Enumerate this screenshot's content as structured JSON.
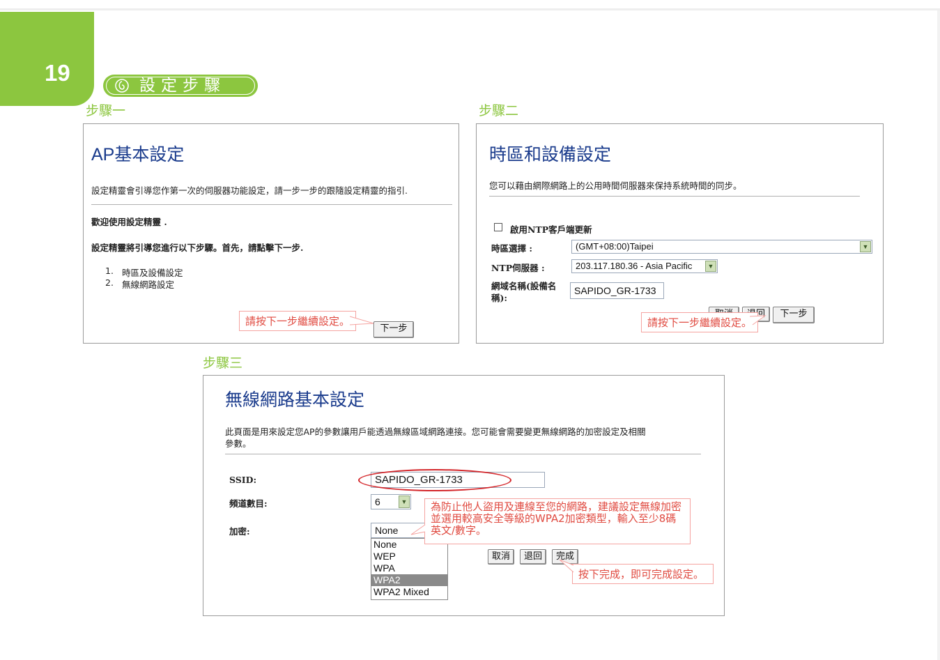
{
  "page": {
    "number": "19",
    "section_title": "設定步驟",
    "accent_color": "#8cc63f",
    "callout_color": "#e04a40"
  },
  "step1": {
    "label": "步驟一",
    "title": "AP基本設定",
    "intro": "設定精靈會引導您作第一次的伺服器功能設定，請一步一步的跟隨設定精靈的指引.",
    "welcome": "歡迎使用設定精靈 .",
    "instruction": "設定精靈將引導您進行以下步驟。首先，請點擊下一步.",
    "list": [
      {
        "num": "1.",
        "text": "時區及設備設定"
      },
      {
        "num": "2.",
        "text": "無線網路設定"
      }
    ],
    "callout": "請按下一步繼續設定。",
    "next_button": "下一步"
  },
  "step2": {
    "label": "步驟二",
    "title": "時區和設備設定",
    "intro": "您可以藉由網際網路上的公用時間伺服器來保持系統時間的同步。",
    "ntp_checkbox_label": "啟用NTP客戶端更新",
    "ntp_checked": false,
    "timezone_label": "時區選擇 :",
    "timezone_value": "(GMT+08:00)Taipei",
    "ntp_server_label": "NTP伺服器 :",
    "ntp_server_value": "203.117.180.36 - Asia Pacific",
    "domain_label_line1": "網域名稱(設備名",
    "domain_label_line2": "稱):",
    "domain_value": "SAPIDO_GR-1733",
    "cancel_button": "取消",
    "back_button": "退回",
    "next_button": "下一步",
    "callout": "請按下一步繼續設定。"
  },
  "step3": {
    "label": "步驟三",
    "title": "無線網路基本設定",
    "intro_line1": "此頁面是用來設定您AP的參數讓用戶能透過無線區域網路連接。您可能會需要變更無線網路的加密設定及相關",
    "intro_line2": "參數。",
    "ssid_label": "SSID:",
    "ssid_value": "SAPIDO_GR-1733",
    "channel_label": "頻道數目:",
    "channel_value": "6",
    "encryption_label": "加密:",
    "encryption_value": "None",
    "encryption_options": [
      "None",
      "WEP",
      "WPA",
      "WPA2",
      "WPA2 Mixed"
    ],
    "encryption_highlighted": "WPA2",
    "cancel_button": "取消",
    "back_button": "退回",
    "finish_button": "完成",
    "callout_security": "為防止他人盜用及連線至您的網路，建議設定無線加密並選用較高安全等級的WPA2加密類型，輸入至少8碼英文/數字。",
    "callout_finish": "按下完成，即可完成設定。"
  }
}
